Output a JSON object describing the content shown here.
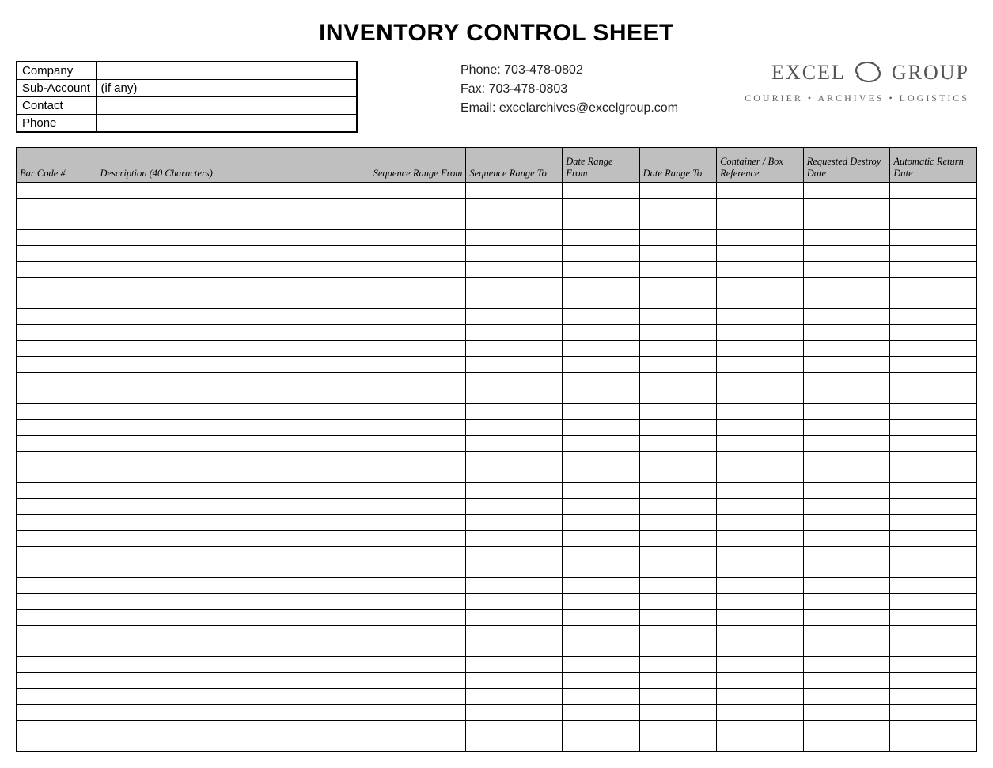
{
  "title": "INVENTORY CONTROL SHEET",
  "info": {
    "company_label": "Company",
    "company_value": "",
    "subaccount_label": "Sub-Account",
    "subaccount_value": "(if any)",
    "contact_label": "Contact",
    "contact_value": "",
    "phone_label": "Phone",
    "phone_value": ""
  },
  "contact": {
    "phone": "Phone:  703-478-0802",
    "fax": "Fax:  703-478-0803",
    "email": "Email:  excelarchives@excelgroup.com"
  },
  "logo": {
    "word1": "EXCEL",
    "word2": "GROUP",
    "tagline": "COURIER • ARCHIVES • LOGISTICS"
  },
  "columns": [
    "Bar Code #",
    "Description (40 Characters)",
    "Sequence Range From",
    "Sequence Range To",
    "Date Range From",
    "Date Range To",
    "Container / Box Reference",
    "Requested Destroy Date",
    "Automatic Return Date"
  ],
  "col_widths": [
    "100px",
    "340px",
    "120px",
    "120px",
    "96px",
    "96px",
    "108px",
    "108px",
    "108px"
  ],
  "row_count": 36
}
